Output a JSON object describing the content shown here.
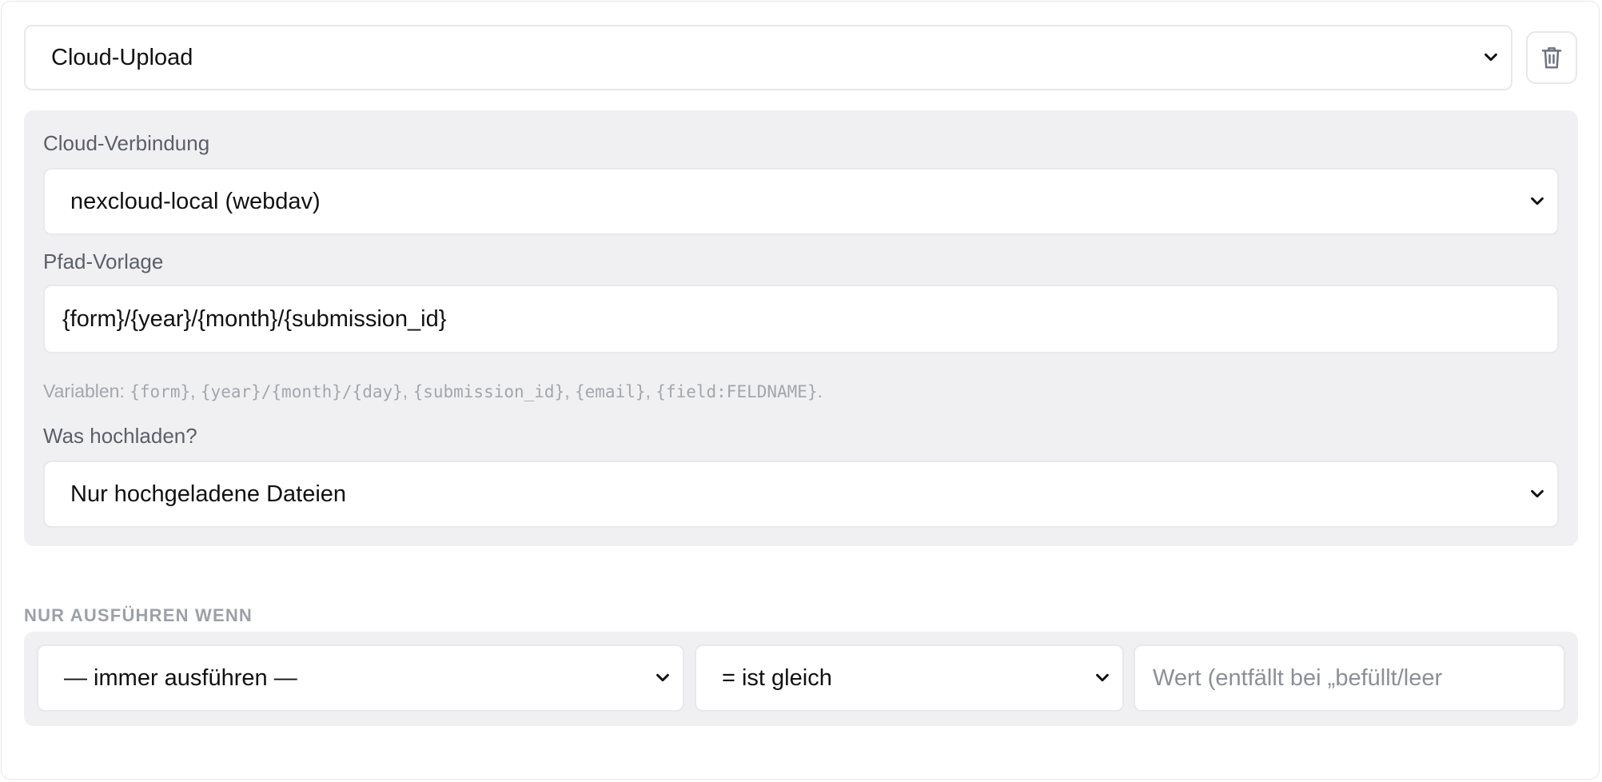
{
  "action": {
    "type_value": "Cloud-Upload",
    "delete_icon": "trash-icon"
  },
  "config": {
    "connection": {
      "label": "Cloud-Verbindung",
      "value": "nexcloud-local (webdav)"
    },
    "path_template": {
      "label": "Pfad-Vorlage",
      "value": "{form}/{year}/{month}/{submission_id}",
      "hint_prefix": "Variablen: ",
      "variables": [
        "{form}",
        "{year}/{month}/{day}",
        "{submission_id}",
        "{email}",
        "{field:FELDNAME}"
      ],
      "separator": ", ",
      "hint_suffix": "."
    },
    "upload_what": {
      "label": "Was hochladen?",
      "value": "Nur hochgeladene Dateien"
    }
  },
  "condition": {
    "title": "NUR AUSFÜHREN WENN",
    "field_value": "— immer ausführen —",
    "operator_value": "= ist gleich",
    "value_placeholder": "Wert (entfällt bei „befüllt/leer"
  },
  "icons": {
    "dropdown": "chevron-down-icon",
    "delete": "trash-icon"
  }
}
